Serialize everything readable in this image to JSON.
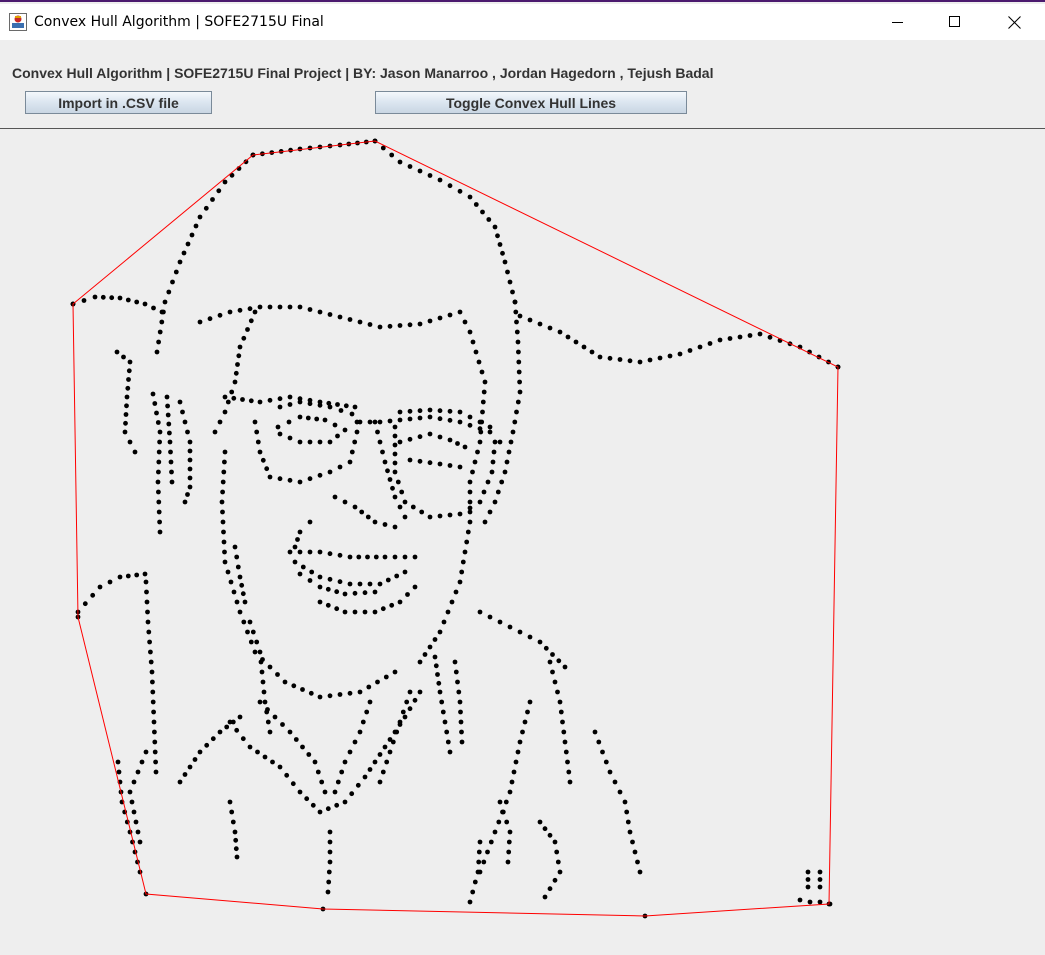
{
  "window": {
    "title": "Convex Hull Algorithm | SOFE2715U Final",
    "icons": [
      "java-app-icon",
      "minimize-icon",
      "maximize-icon",
      "close-icon"
    ]
  },
  "header": {
    "credits": "Convex Hull Algorithm | SOFE2715U Final Project | BY:   Jason Manarroo , Jordan Hagedorn , Tejush Badal"
  },
  "toolbar": {
    "import_label": "Import in .CSV file",
    "toggle_label": "Toggle Convex Hull Lines"
  },
  "colors": {
    "hull_line": "#ff0000",
    "points": "#000000",
    "background": "#eeeeee"
  }
}
